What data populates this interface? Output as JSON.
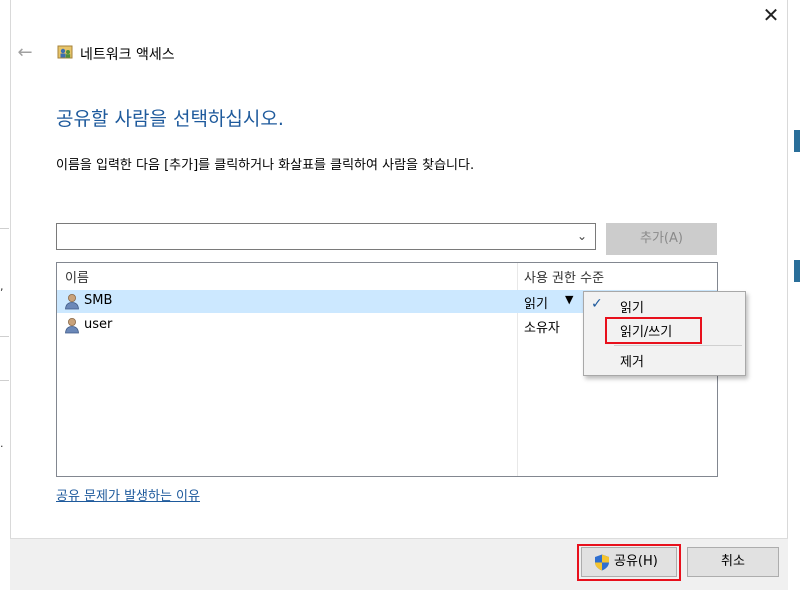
{
  "window": {
    "title": "네트워크 액세스",
    "close_glyph": "✕",
    "back_glyph": "←"
  },
  "heading": "공유할 사람을 선택하십시오.",
  "instruction": "이름을 입력한 다음 [추가]를 클릭하거나 화살표를 클릭하여 사람을 찾습니다.",
  "name_input": {
    "value": "",
    "placeholder": ""
  },
  "add_button": "추가(A)",
  "list": {
    "headers": {
      "name": "이름",
      "permission": "사용 권한 수준"
    },
    "rows": [
      {
        "name": "SMB",
        "permission": "읽기",
        "selected": true
      },
      {
        "name": "user",
        "permission": "소유자",
        "selected": false
      }
    ]
  },
  "permission_menu": {
    "items": [
      {
        "label": "읽기",
        "checked": true
      },
      {
        "label": "읽기/쓰기",
        "highlighted": true
      },
      {
        "label": "제거"
      }
    ]
  },
  "help_link": "공유 문제가 발생하는 이유",
  "footer": {
    "share_button": "공유(H)",
    "cancel_button": "취소"
  },
  "colors": {
    "accent": "#1e5a9c",
    "selection": "#cce8ff",
    "highlight_box": "#e8101c"
  }
}
